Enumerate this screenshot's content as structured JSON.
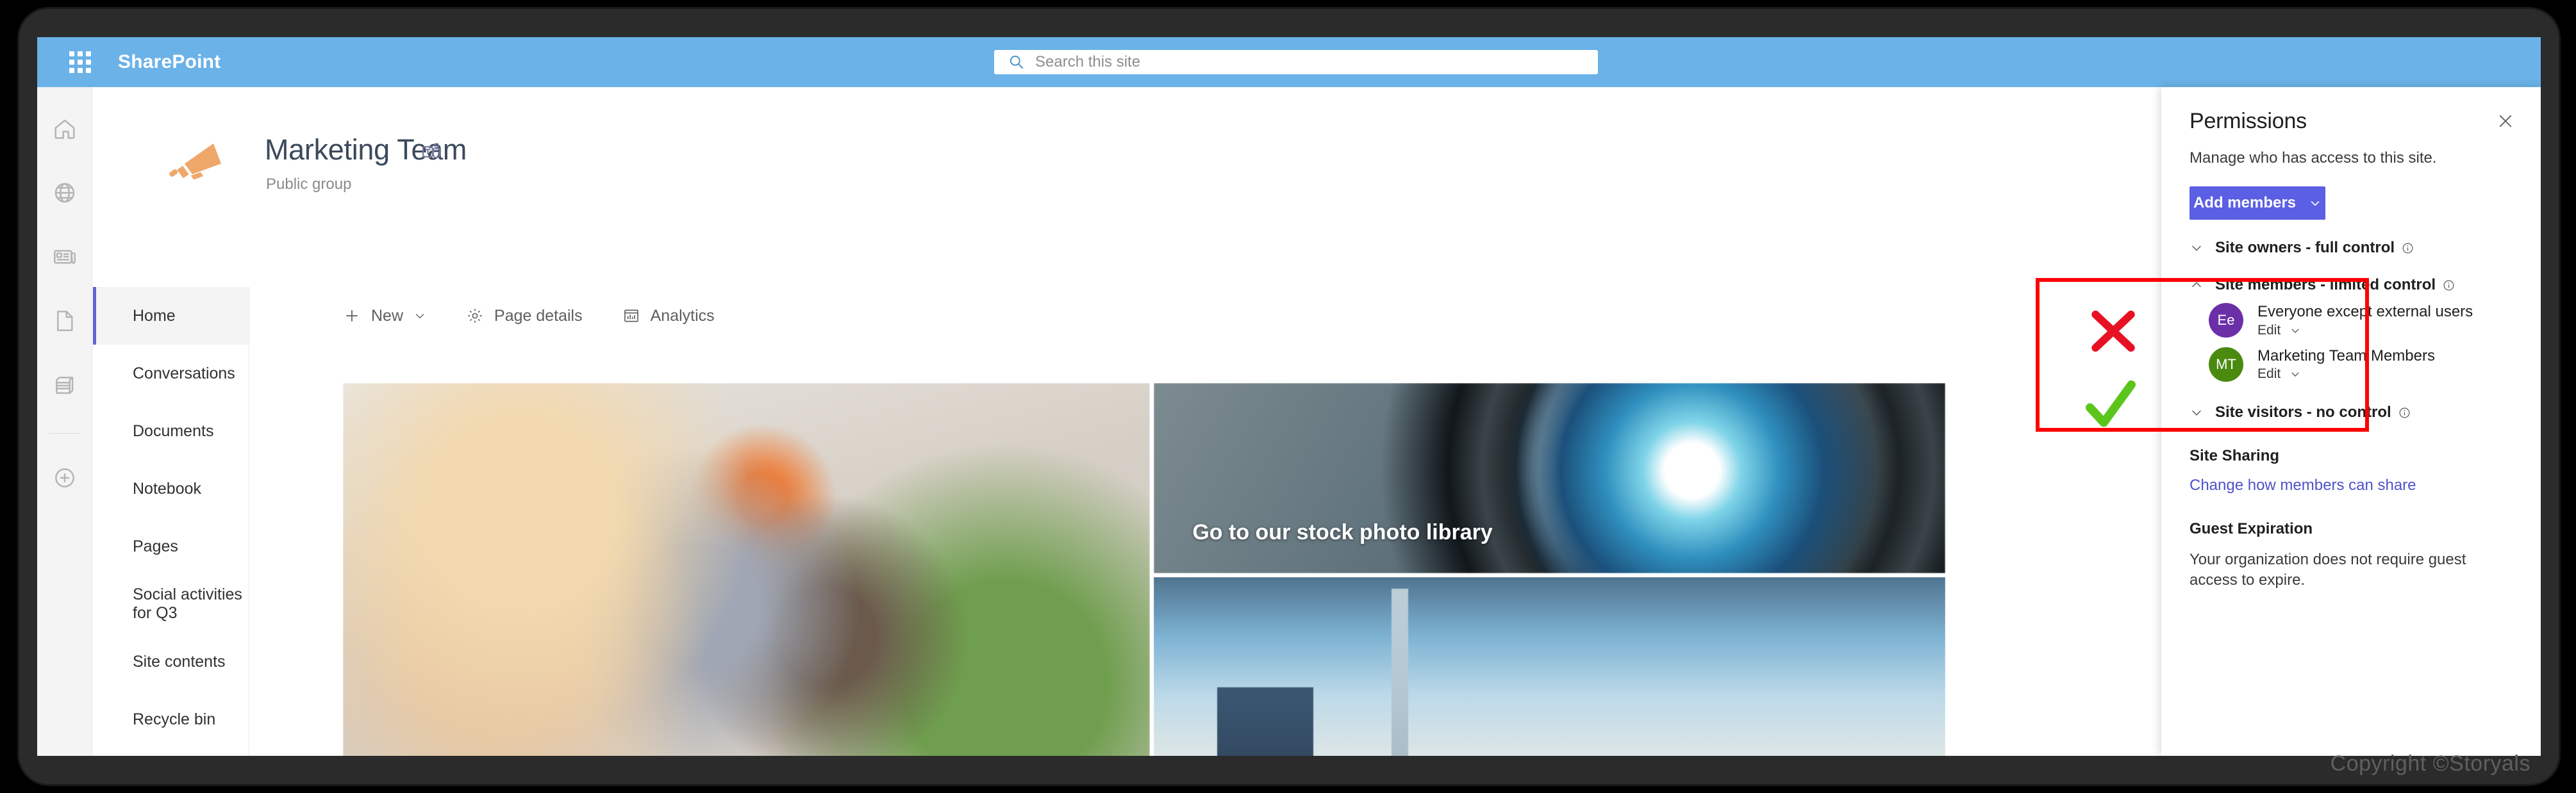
{
  "suite": {
    "waffle_icon": "waffle-grid-icon",
    "brand": "SharePoint",
    "search": {
      "icon": "search-icon",
      "placeholder": "Search this site",
      "value": ""
    },
    "bar_color": "#6ab2e7"
  },
  "rail": {
    "items": [
      {
        "icon": "home-icon",
        "name": "home"
      },
      {
        "icon": "globe-icon",
        "name": "global-navigation"
      },
      {
        "icon": "news-icon",
        "name": "news"
      },
      {
        "icon": "page-icon",
        "name": "pages"
      },
      {
        "icon": "lists-icon",
        "name": "lists"
      },
      {
        "icon": "create-plus-icon",
        "name": "create"
      }
    ]
  },
  "site": {
    "logo_icon": "megaphone-icon",
    "logo_color": "#efa76a",
    "title": "Marketing Team",
    "teams_badge_icon": "microsoft-teams-icon",
    "subtitle": "Public group"
  },
  "nav": {
    "items": [
      {
        "label": "Home",
        "selected": true
      },
      {
        "label": "Conversations",
        "selected": false
      },
      {
        "label": "Documents",
        "selected": false
      },
      {
        "label": "Notebook",
        "selected": false
      },
      {
        "label": "Pages",
        "selected": false
      },
      {
        "label": "Social activities for Q3",
        "selected": false
      },
      {
        "label": "Site contents",
        "selected": false
      },
      {
        "label": "Recycle bin",
        "selected": false
      }
    ],
    "selected_indicator_color": "#6264cf"
  },
  "commandbar": {
    "items": [
      {
        "label": "New",
        "icon": "plus-icon",
        "has_chevron": true
      },
      {
        "label": "Page details",
        "icon": "gear-icon",
        "has_chevron": false
      },
      {
        "label": "Analytics",
        "icon": "analytics-chart-icon",
        "has_chevron": false
      }
    ]
  },
  "hero": {
    "tiles": [
      {
        "name": "office-team-photo",
        "caption": ""
      },
      {
        "name": "camera-lens-photo",
        "caption": "Go to our stock photo library"
      },
      {
        "name": "city-sky-photo",
        "caption": ""
      }
    ]
  },
  "panel": {
    "title": "Permissions",
    "close_icon": "close-icon",
    "subtitle": "Manage who has access to this site.",
    "add_button": {
      "label": "Add members",
      "chevron_icon": "chevron-down-icon",
      "color": "#5b5fe3"
    },
    "groups": [
      {
        "label": "Site owners - full control",
        "expanded": false,
        "chevron_icon": "chevron-down-icon",
        "info_icon": "info-icon",
        "members": []
      },
      {
        "label": "Site members - limited control",
        "expanded": true,
        "chevron_icon": "chevron-up-icon",
        "info_icon": "info-icon",
        "highlighted": true,
        "members": [
          {
            "initials": "Ee",
            "avatar_color": "#6b2fa8",
            "name": "Everyone except external users",
            "role": "Edit",
            "role_chevron_icon": "chevron-down-icon",
            "annotation": "red-x"
          },
          {
            "initials": "MT",
            "avatar_color": "#4a8a0f",
            "name": "Marketing Team Members",
            "role": "Edit",
            "role_chevron_icon": "chevron-down-icon",
            "annotation": "green-check"
          }
        ]
      },
      {
        "label": "Site visitors - no control",
        "expanded": false,
        "chevron_icon": "chevron-down-icon",
        "info_icon": "info-icon",
        "members": []
      }
    ],
    "site_sharing": {
      "heading": "Site Sharing",
      "link": "Change how members can share"
    },
    "guest_expiration": {
      "heading": "Guest Expiration",
      "text": "Your organization does not require guest access to expire."
    }
  },
  "annotations": {
    "highlight_color": "#ff0000",
    "x_mark_color": "#e81123",
    "check_mark_color": "#5cc51b"
  },
  "watermark": "Copyright ©Storyals"
}
